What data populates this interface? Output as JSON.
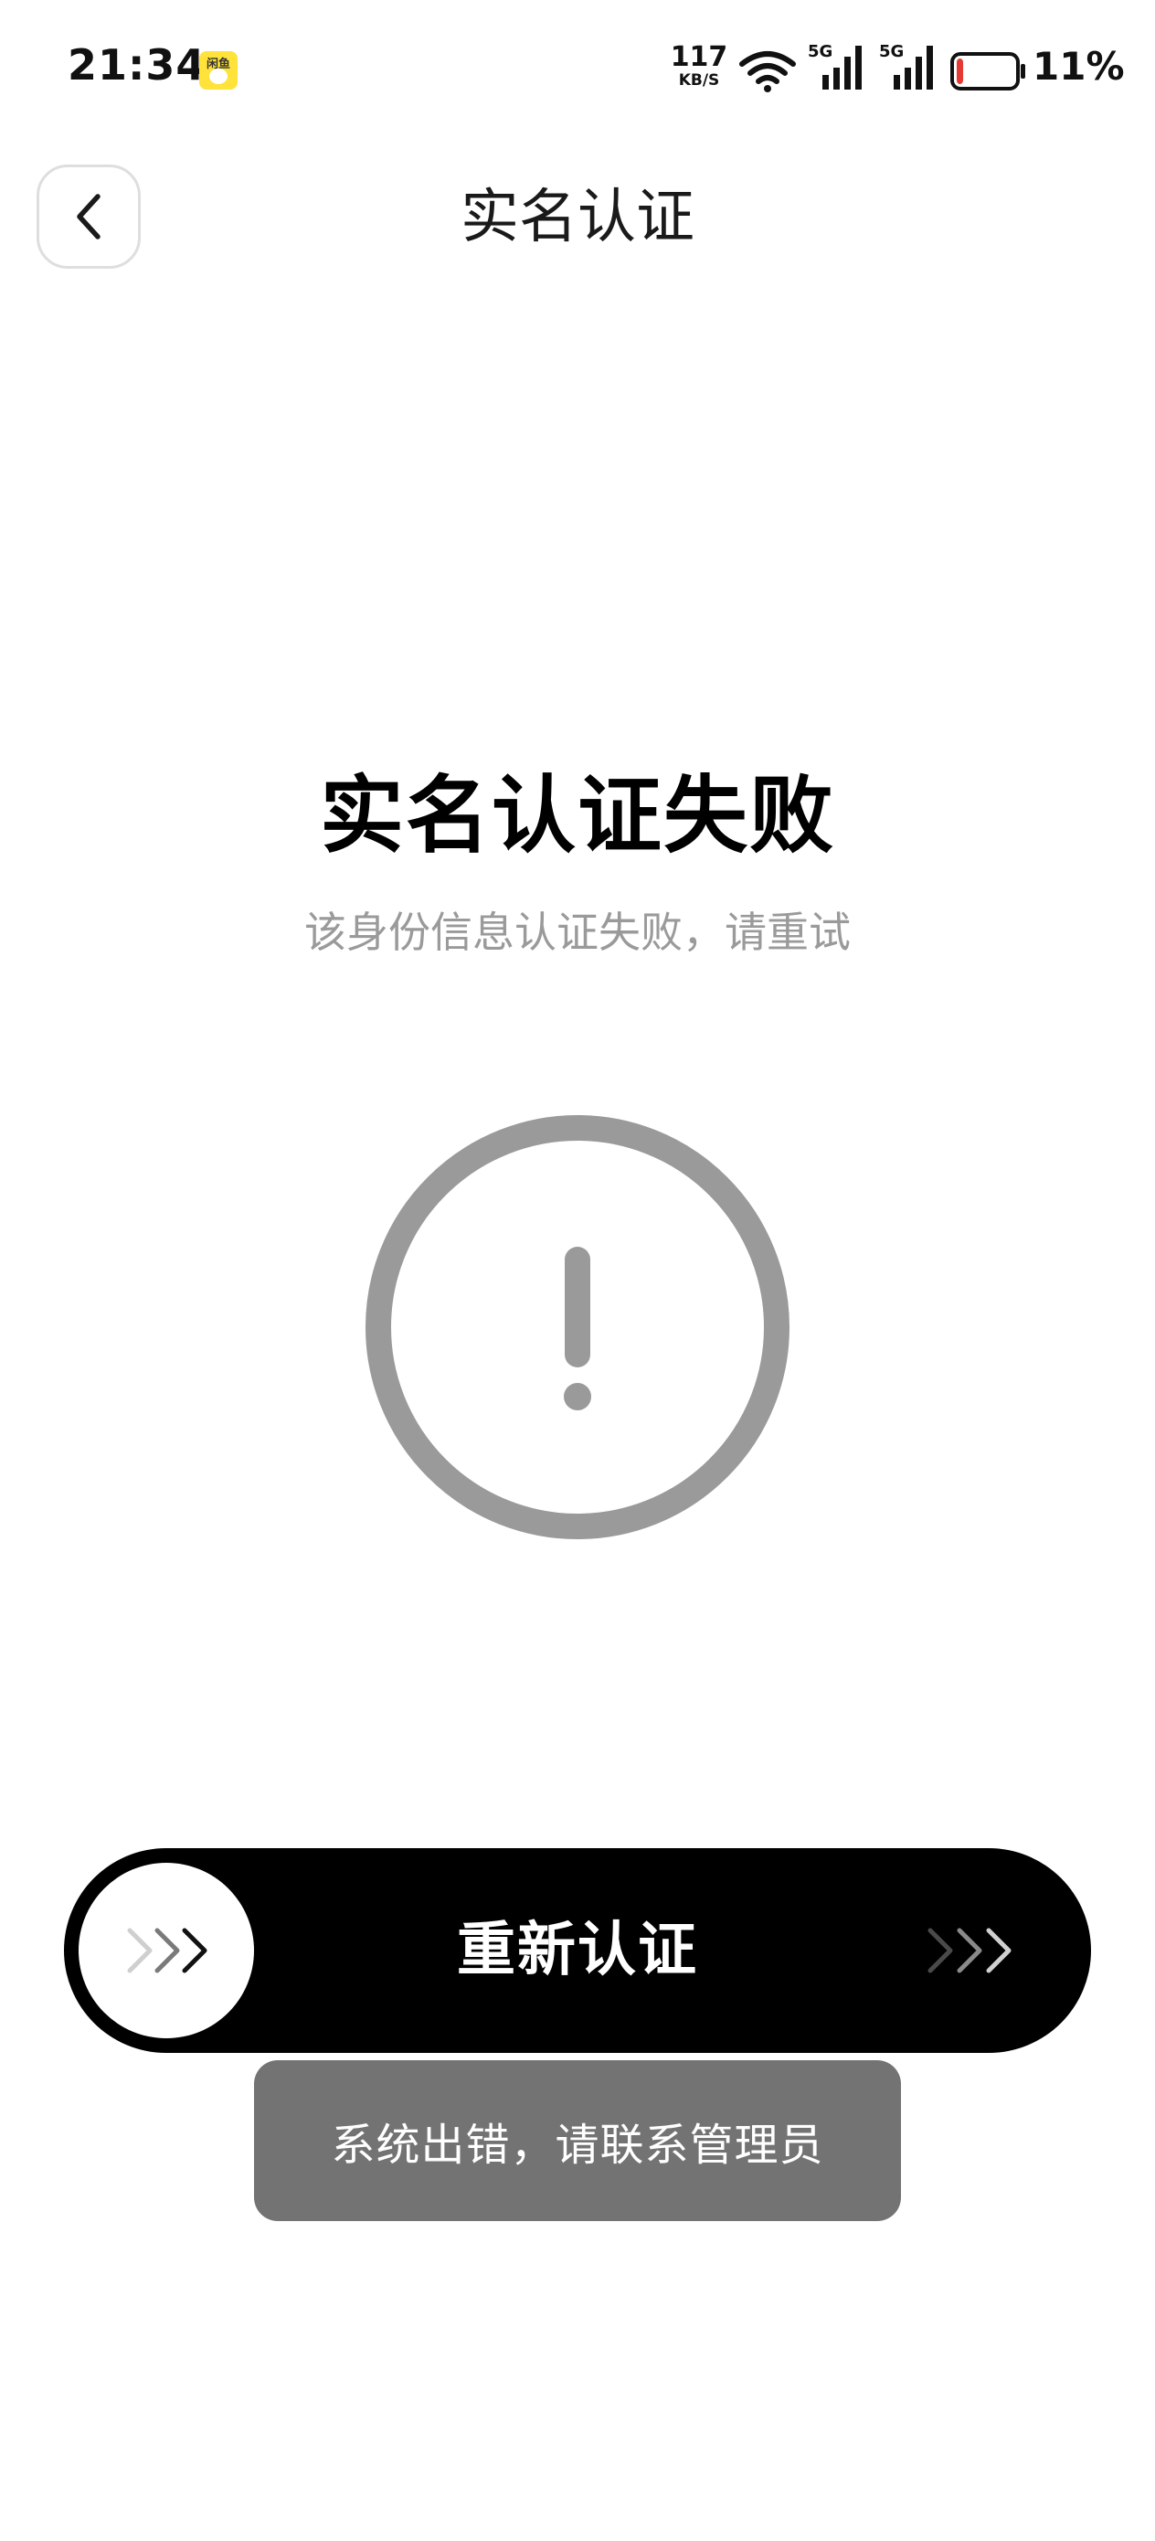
{
  "status_bar": {
    "time": "21:34",
    "app_badge_text": "闲鱼",
    "net_speed_value": "117",
    "net_speed_unit": "KB/S",
    "signal_1_label": "5G",
    "signal_2_label": "5G",
    "battery_percent": "11%",
    "battery_level": 0.11,
    "battery_color": "#e53935"
  },
  "header": {
    "title": "实名认证"
  },
  "result": {
    "title": "实名认证失败",
    "subtitle": "该身份信息认证失败，请重试",
    "icon": "exclamation-circle-icon",
    "icon_color": "#9a9a9a"
  },
  "slide_button": {
    "label": "重新认证",
    "knob_icon": "triple-chevron-right-icon",
    "trail_icon": "triple-chevron-right-icon"
  },
  "toast": {
    "message": "系统出错，请联系管理员"
  }
}
